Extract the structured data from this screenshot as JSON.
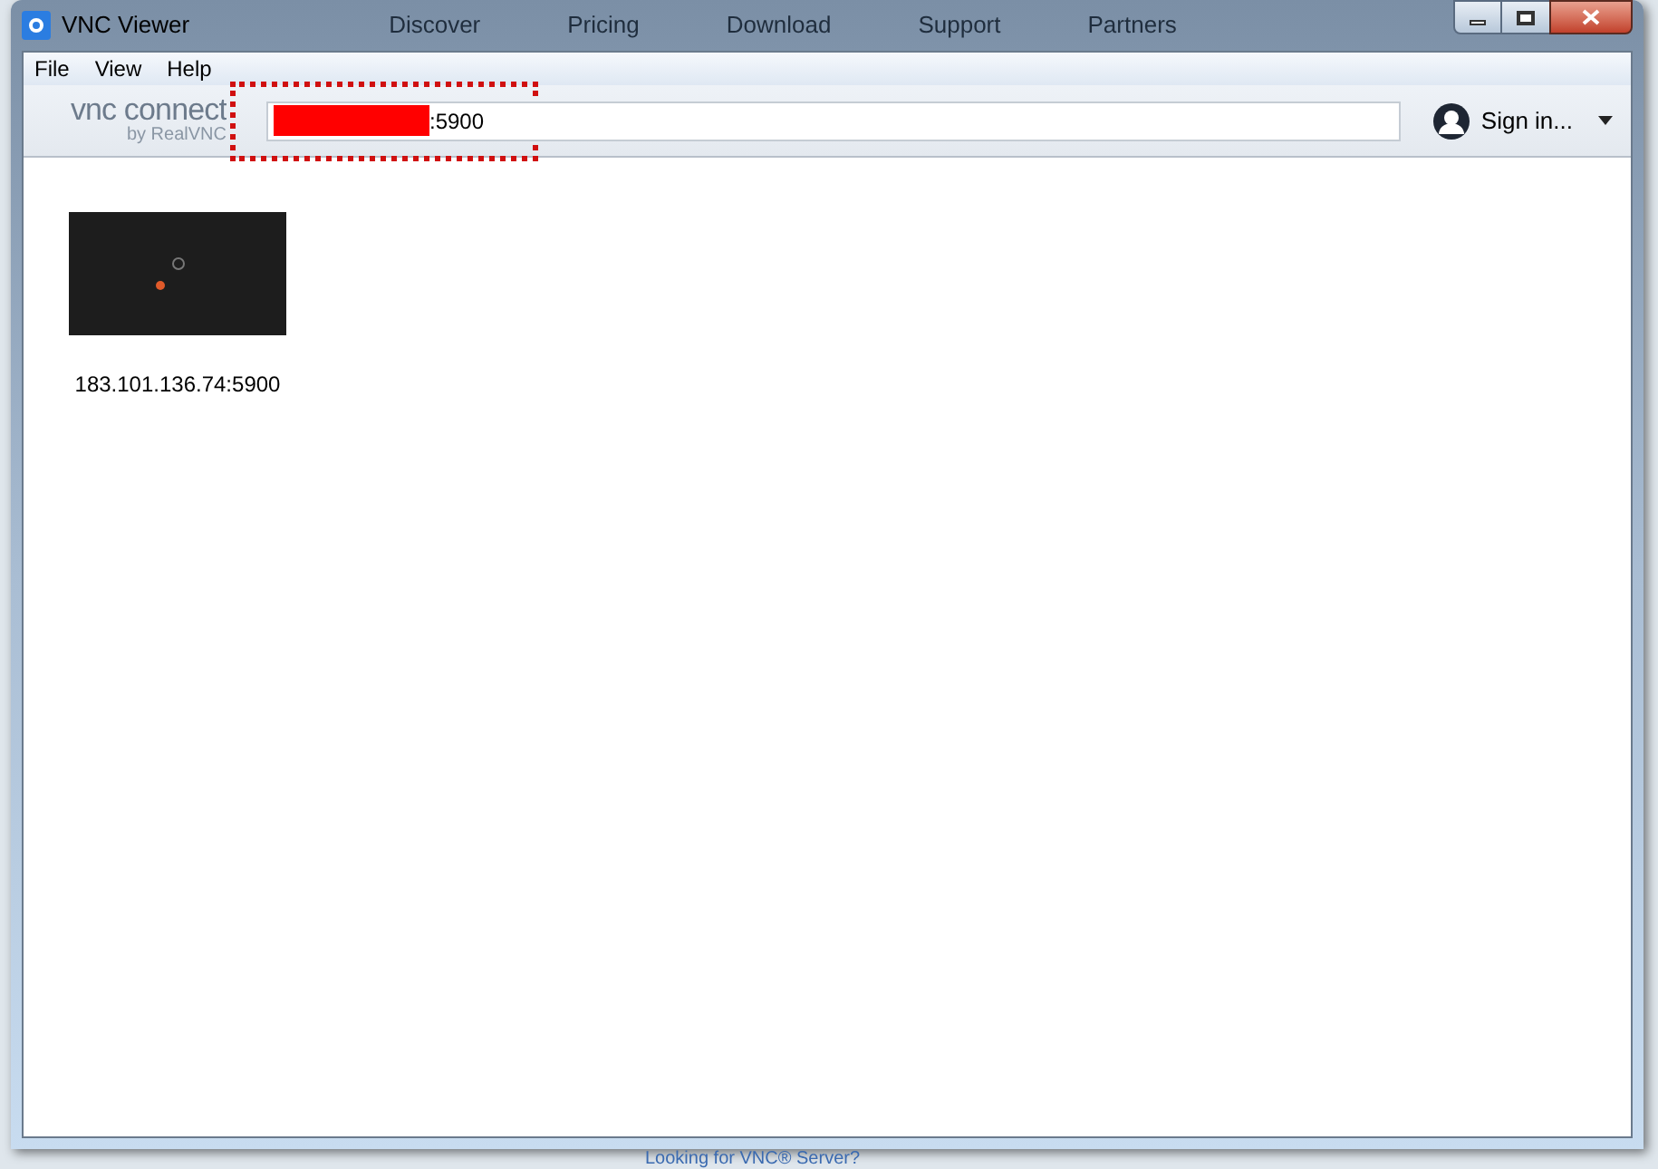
{
  "background_page": {
    "nav": [
      "Discover",
      "Pricing",
      "Download",
      "Support",
      "Partners"
    ],
    "footer_link": "Looking for VNC® Server?"
  },
  "window": {
    "title": "VNC Viewer"
  },
  "menu": [
    "File",
    "View",
    "Help"
  ],
  "toolbar": {
    "logo_text": "vnc connect",
    "logo_byline": "by RealVNC",
    "address": {
      "value": ":5900",
      "redacted": true,
      "highlighted": true
    },
    "sign_in": "Sign in..."
  },
  "connections": [
    {
      "label": "183.101.136.74:5900"
    }
  ]
}
